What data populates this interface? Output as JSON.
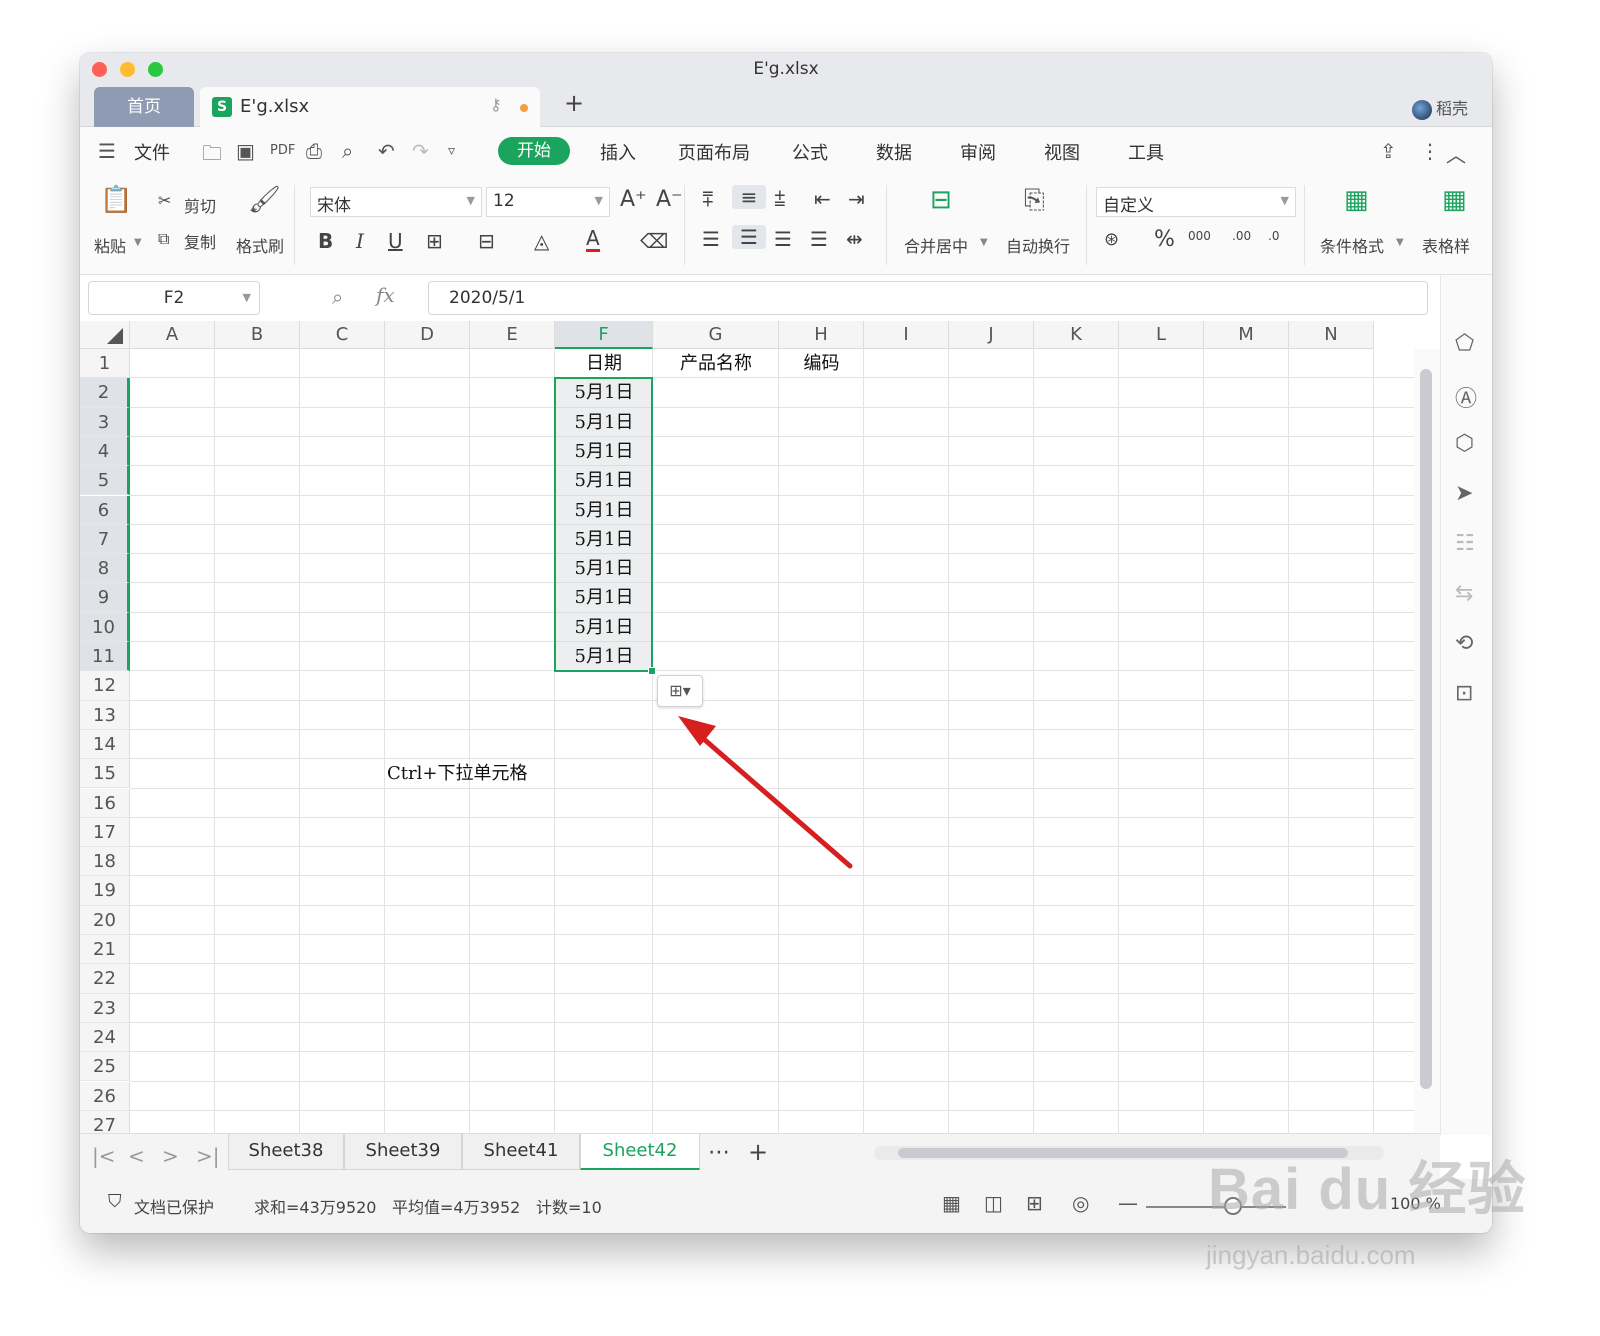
{
  "window": {
    "title": "E'g.xlsx"
  },
  "tabs": {
    "home": "首页",
    "file_logo": "S",
    "file": "E'g.xlsx",
    "new": "+"
  },
  "account": {
    "name": "稻壳"
  },
  "menu": {
    "file": "文件",
    "start": "开始",
    "items": [
      "插入",
      "页面布局",
      "公式",
      "数据",
      "审阅",
      "视图",
      "工具"
    ]
  },
  "ribbon": {
    "paste": "粘贴",
    "cut": "剪切",
    "copy": "复制",
    "format_painter": "格式刷",
    "font": "宋体",
    "font_size": "12",
    "merge": "合并居中",
    "wrap": "自动换行",
    "number_format": "自定义",
    "cond_format": "条件格式",
    "table_style": "表格样"
  },
  "formula": {
    "cell_ref": "F2",
    "fx": "fx",
    "value": "2020/5/1"
  },
  "sheet": {
    "columns": [
      "A",
      "B",
      "C",
      "D",
      "E",
      "F",
      "G",
      "H",
      "I",
      "J",
      "K",
      "L",
      "M",
      "N"
    ],
    "selected_column": "F",
    "rows": [
      "1",
      "2",
      "3",
      "4",
      "5",
      "6",
      "7",
      "8",
      "9",
      "10",
      "11",
      "12",
      "13",
      "14",
      "15",
      "16",
      "17",
      "18",
      "19",
      "20",
      "21",
      "22",
      "23",
      "24",
      "25",
      "26",
      "27"
    ],
    "headers": {
      "F1": "日期",
      "G1": "产品名称",
      "H1": "编码"
    },
    "dates": [
      "5月1日",
      "5月1日",
      "5月1日",
      "5月1日",
      "5月1日",
      "5月1日",
      "5月1日",
      "5月1日",
      "5月1日",
      "5月1日"
    ],
    "annotation": "Ctrl+下拉单元格"
  },
  "sheet_tabs": [
    "Sheet38",
    "Sheet39",
    "Sheet41",
    "Sheet42"
  ],
  "active_sheet": "Sheet42",
  "status": {
    "protected": "文档已保护",
    "sum": "求和=43万9520",
    "average": "平均值=4万3952",
    "count": "计数=10",
    "zoom": "100 %"
  },
  "watermark": {
    "brand": "Bai du 经验",
    "url": "jingyan.baidu.com"
  },
  "colors": {
    "accent": "#1aa45d",
    "arrow": "#d6201f"
  }
}
